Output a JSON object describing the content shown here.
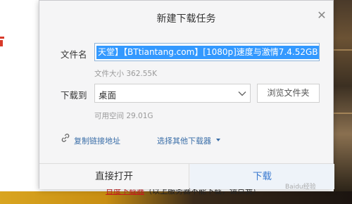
{
  "dialog": {
    "title": "新建下载任务",
    "filename_label": "文件名",
    "filename_value": "天堂】【BTtiantang.com】[1080p]速度与激情7.4.52GB",
    "file_size": "文件大小 362.55K",
    "save_to_label": "下载到",
    "folder_value": "桌面",
    "browse_label": "浏览文件夹",
    "free_space": "可用空间 29.01G",
    "copy_link_label": "复制链接地址",
    "choose_downloader_label": "选择其他下载器",
    "open_label": "直接打开",
    "download_label": "下载"
  },
  "background": {
    "bottom_text_red": "百度下载器",
    "bottom_text_rest": "（以上服务器不能下载，请点我）"
  },
  "watermark": "Baidu经验",
  "icons": [
    "close-icon",
    "chevron-down-icon",
    "link-icon",
    "caret-down-icon"
  ],
  "colors": {
    "accent": "#3399ff",
    "link": "#3a6ea8",
    "download_text": "#3a7ad0"
  }
}
